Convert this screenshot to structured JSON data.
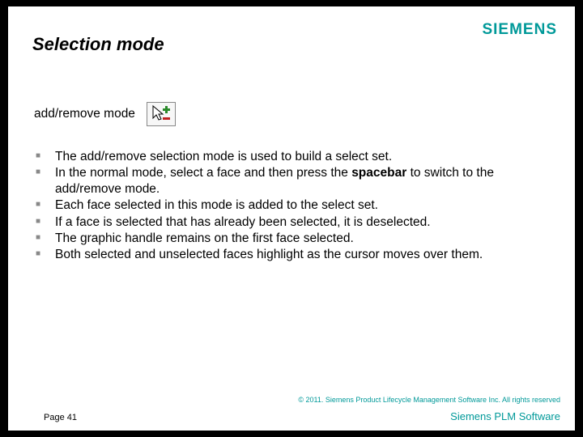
{
  "header": {
    "title": "Selection mode",
    "logo": "SIEMENS"
  },
  "subheader": "add/remove mode",
  "icon_name": "cursor-add-remove-icon",
  "bullets": [
    {
      "pre": "The add/remove selection mode is used to build a select set.",
      "bold": "",
      "post": ""
    },
    {
      "pre": "In the normal mode, select a face and then press the ",
      "bold": "spacebar",
      "post": " to switch to the add/remove mode."
    },
    {
      "pre": "Each face selected in this mode is added to the select set.",
      "bold": "",
      "post": ""
    },
    {
      "pre": "If a face is selected that has already been selected, it is deselected.",
      "bold": "",
      "post": ""
    },
    {
      "pre": "The graphic handle remains on the first face selected.",
      "bold": "",
      "post": ""
    },
    {
      "pre": "Both selected and unselected faces highlight as the cursor moves over them.",
      "bold": "",
      "post": ""
    }
  ],
  "footer": {
    "copyright": "© 2011. Siemens Product Lifecycle Management Software Inc. All rights reserved",
    "page": "Page 41",
    "brand": "Siemens PLM Software"
  }
}
